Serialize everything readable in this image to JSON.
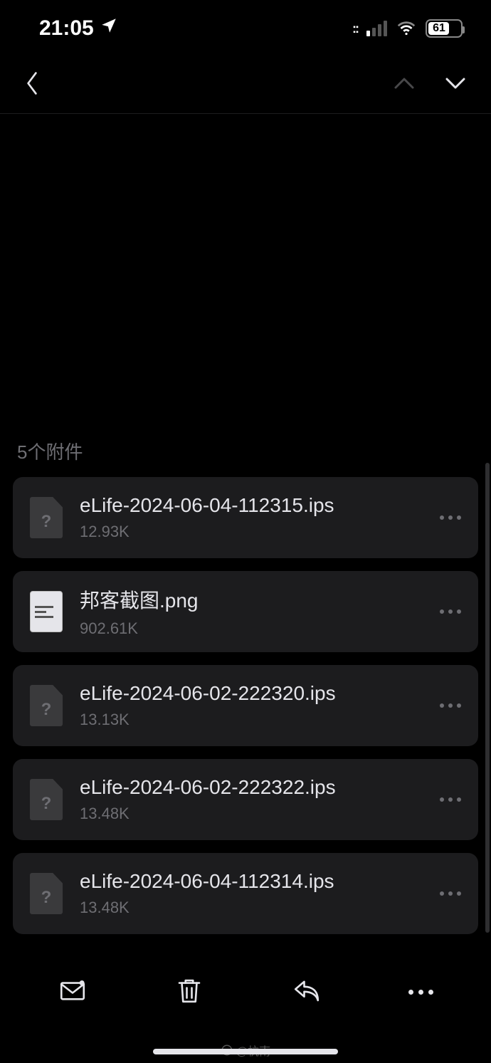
{
  "status": {
    "time": "21:05",
    "battery_pct": "61"
  },
  "section": {
    "title": "5个附件"
  },
  "attachments": [
    {
      "name": "eLife-2024-06-04-112315.ips",
      "size": "12.93K",
      "kind": "file"
    },
    {
      "name": "邦客截图.png",
      "size": "902.61K",
      "kind": "png"
    },
    {
      "name": "eLife-2024-06-02-222320.ips",
      "size": "13.13K",
      "kind": "file"
    },
    {
      "name": "eLife-2024-06-02-222322.ips",
      "size": "13.48K",
      "kind": "file"
    },
    {
      "name": "eLife-2024-06-04-112314.ips",
      "size": "13.48K",
      "kind": "file"
    }
  ],
  "watermark": "@杭南"
}
